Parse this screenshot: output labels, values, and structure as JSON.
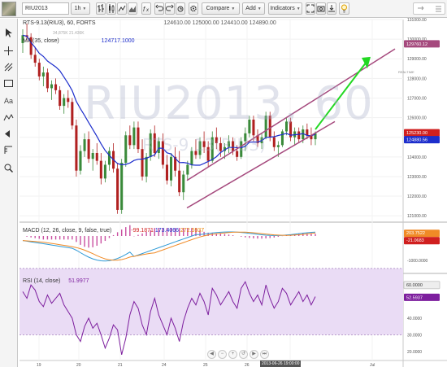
{
  "toolbar": {
    "symbol": "RIU2013",
    "interval": "1h",
    "compare_label": "Compare",
    "add_label": "Add",
    "indicators_label": "Indicators",
    "dropdown_arrow": "▼"
  },
  "main": {
    "title": "RTS-9.13(RIU3), 60, FORTS",
    "ohlc": [
      "124610.00",
      "125000.00",
      "124410.00",
      "124890.00"
    ],
    "ma_label": "MA (35, close)",
    "ma_value": "124717.1000",
    "volume_text": "34,875K  21.436K",
    "watermark_line1": "RIU2013, 60",
    "watermark_line2": "RTS-9.13(RIU3)",
    "realtime_label": "REALTIME",
    "price_axis": [
      "131000.00",
      "130000.00",
      "129000.00",
      "128000.00",
      "127000.00",
      "126000.00",
      "125000.00",
      "124000.00",
      "123000.00",
      "122000.00",
      "121000.00"
    ],
    "price_tag_top": "129760.12",
    "price_tag_red": "125230.00",
    "price_tag_blue": "124880.56"
  },
  "macd": {
    "label": "MACD (12, 26, close, 9, false, true)",
    "v1": "-99.1871",
    "v2": "173.4066",
    "v3": "272.5937",
    "axis": [
      "0.0000",
      "-1000.0000"
    ],
    "tag_orange": "203.7522",
    "tag_red": "-21.0683"
  },
  "rsi": {
    "label": "RSI (14, close)",
    "value": "51.9977",
    "axis": [
      "60.0000",
      "40.0000",
      "30.0000",
      "20.0000"
    ],
    "tag_top": "60.0000",
    "tag_value": "52.5937"
  },
  "x_axis": [
    "19",
    "20",
    "21",
    "24",
    "25",
    "26",
    "27",
    "Jul"
  ],
  "x_axis_highlight": "2013-06-26 19:00:00",
  "colors": {
    "up_candle": "#3a8a3a",
    "down_candle": "#b02020",
    "ma_line": "#1d2ecc",
    "channel": "#a5497d",
    "arrow": "#22d822",
    "macd_line": "#2f9ad6",
    "signal_line": "#f08a26",
    "hist": "#c94fa0",
    "rsi_line": "#7d1f9e",
    "rsi_band": "#eadcf5"
  },
  "icons": {
    "sidebar": [
      "cursor-icon",
      "crosshair-icon",
      "trendline-icon",
      "pitchfork-icon",
      "rectangle-icon",
      "text-icon",
      "patterns-icon",
      "arrow-marker-icon",
      "measure-icon",
      "zoom-icon"
    ],
    "toolbar": [
      "bar-style-icon",
      "candle-style-icon",
      "line-style-icon",
      "area-style-icon",
      "fx-icon",
      "settings-icon",
      "undo-icon",
      "redo-icon",
      "alert-icon",
      "fullscreen-icon",
      "camera-icon",
      "download-icon",
      "lightbulb-icon"
    ]
  }
}
